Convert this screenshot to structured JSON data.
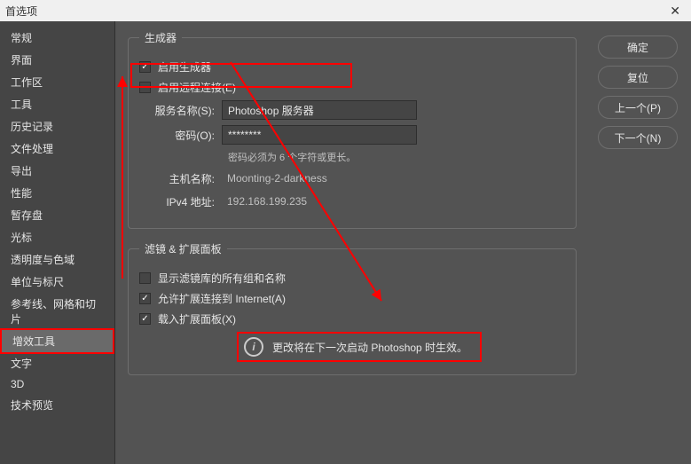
{
  "titlebar": {
    "title": "首选项"
  },
  "sidebar": {
    "items": [
      {
        "label": "常规"
      },
      {
        "label": "界面"
      },
      {
        "label": "工作区"
      },
      {
        "label": "工具"
      },
      {
        "label": "历史记录"
      },
      {
        "label": "文件处理"
      },
      {
        "label": "导出"
      },
      {
        "label": "性能"
      },
      {
        "label": "暂存盘"
      },
      {
        "label": "光标"
      },
      {
        "label": "透明度与色域"
      },
      {
        "label": "单位与标尺"
      },
      {
        "label": "参考线、网格和切片"
      },
      {
        "label": "增效工具"
      },
      {
        "label": "文字"
      },
      {
        "label": "3D"
      },
      {
        "label": "技术预览"
      }
    ]
  },
  "generator": {
    "legend": "生成器",
    "enable_label": "启用生成器",
    "remote_label": "启用远程连接(E)",
    "service_name_label": "服务名称(S):",
    "service_name_value": "Photoshop 服务器",
    "password_label": "密码(O):",
    "password_value": "********",
    "password_hint": "密码必须为 6 个字符或更长。",
    "host_label": "主机名称:",
    "host_value": "Moonting-2-darkness",
    "ipv4_label": "IPv4 地址:",
    "ipv4_value": "192.168.199.235"
  },
  "filters": {
    "legend": "滤镜 & 扩展面板",
    "show_all_label": "显示滤镜库的所有组和名称",
    "allow_internet_label": "允许扩展连接到 Internet(A)",
    "load_panels_label": "载入扩展面板(X)",
    "restart_msg": "更改将在下一次启动 Photoshop 时生效。"
  },
  "buttons": {
    "ok": "确定",
    "reset": "复位",
    "prev": "上一个(P)",
    "next": "下一个(N)"
  }
}
